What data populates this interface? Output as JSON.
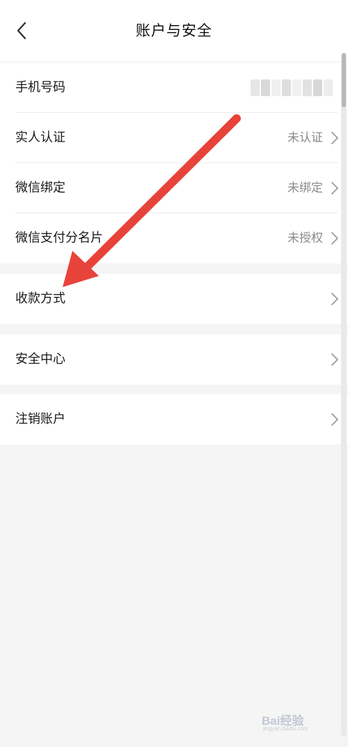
{
  "header": {
    "title": "账户与安全",
    "back_icon": "chevron-left-icon"
  },
  "groups": [
    {
      "rows": [
        {
          "label": "手机号码",
          "value": ""
        },
        {
          "label": "实人认证",
          "value": "未认证"
        },
        {
          "label": "微信绑定",
          "value": "未绑定"
        },
        {
          "label": "微信支付分名片",
          "value": "未授权"
        }
      ]
    },
    {
      "rows": [
        {
          "label": "收款方式",
          "value": ""
        }
      ]
    },
    {
      "rows": [
        {
          "label": "安全中心",
          "value": ""
        }
      ]
    },
    {
      "rows": [
        {
          "label": "注销账户",
          "value": ""
        }
      ]
    }
  ],
  "colors": {
    "background": "#f5f5f5",
    "card": "#ffffff",
    "arrow": "#e8433a",
    "value_text": "#8a8a8a"
  },
  "watermark": {
    "text": "Bai经验",
    "sub": "jingyan.baidu.com"
  }
}
